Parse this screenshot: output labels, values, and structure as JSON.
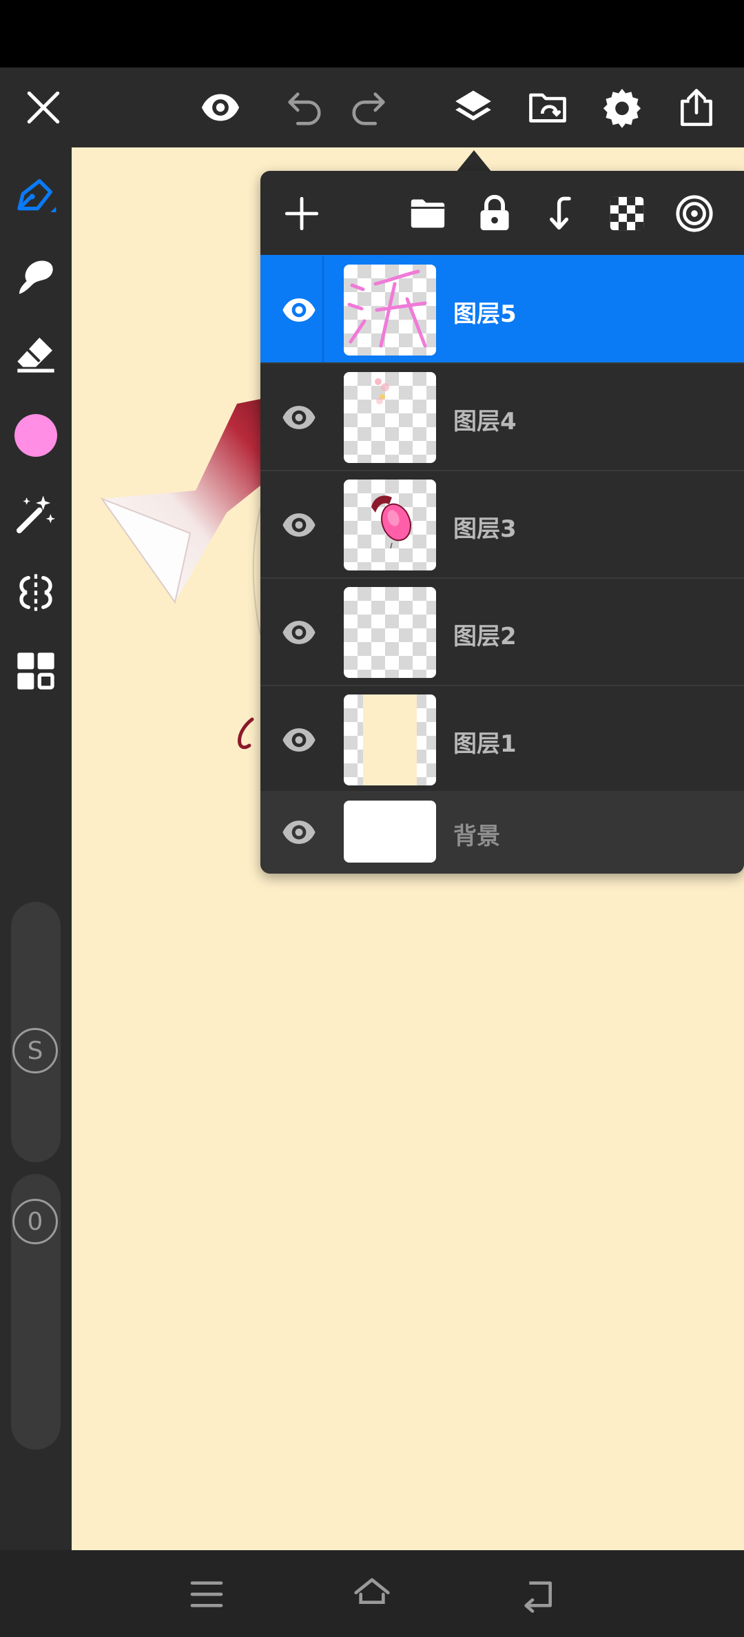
{
  "app": {
    "accent_color": "#0a7af5",
    "current_color": "#ff8ee4",
    "canvas_color": "#fdeec8"
  },
  "top_toolbar": {
    "icons": [
      "close-icon",
      "eye-icon",
      "undo-icon",
      "redo-icon",
      "layers-icon",
      "gallery-icon",
      "settings-icon",
      "share-icon"
    ]
  },
  "left_toolbar": {
    "tools": [
      "brush-icon",
      "smudge-icon",
      "eraser-icon",
      "color-swatch",
      "magic-wand-icon",
      "symmetry-icon",
      "grid-icon"
    ],
    "size_slider_label": "S",
    "opacity_slider_label": "0"
  },
  "layers_panel": {
    "header_icons": [
      "add-icon",
      "folder-icon",
      "lock-icon",
      "merge-down-icon",
      "checkerboard-icon",
      "target-icon"
    ],
    "layers": [
      {
        "name": "图层5",
        "active": true
      },
      {
        "name": "图层4",
        "active": false
      },
      {
        "name": "图层3",
        "active": false
      },
      {
        "name": "图层2",
        "active": false
      },
      {
        "name": "图层1",
        "active": false
      }
    ],
    "background": {
      "name": "背景"
    }
  },
  "nav_bar": {
    "icons": [
      "menu-icon",
      "home-icon",
      "back-icon"
    ]
  }
}
